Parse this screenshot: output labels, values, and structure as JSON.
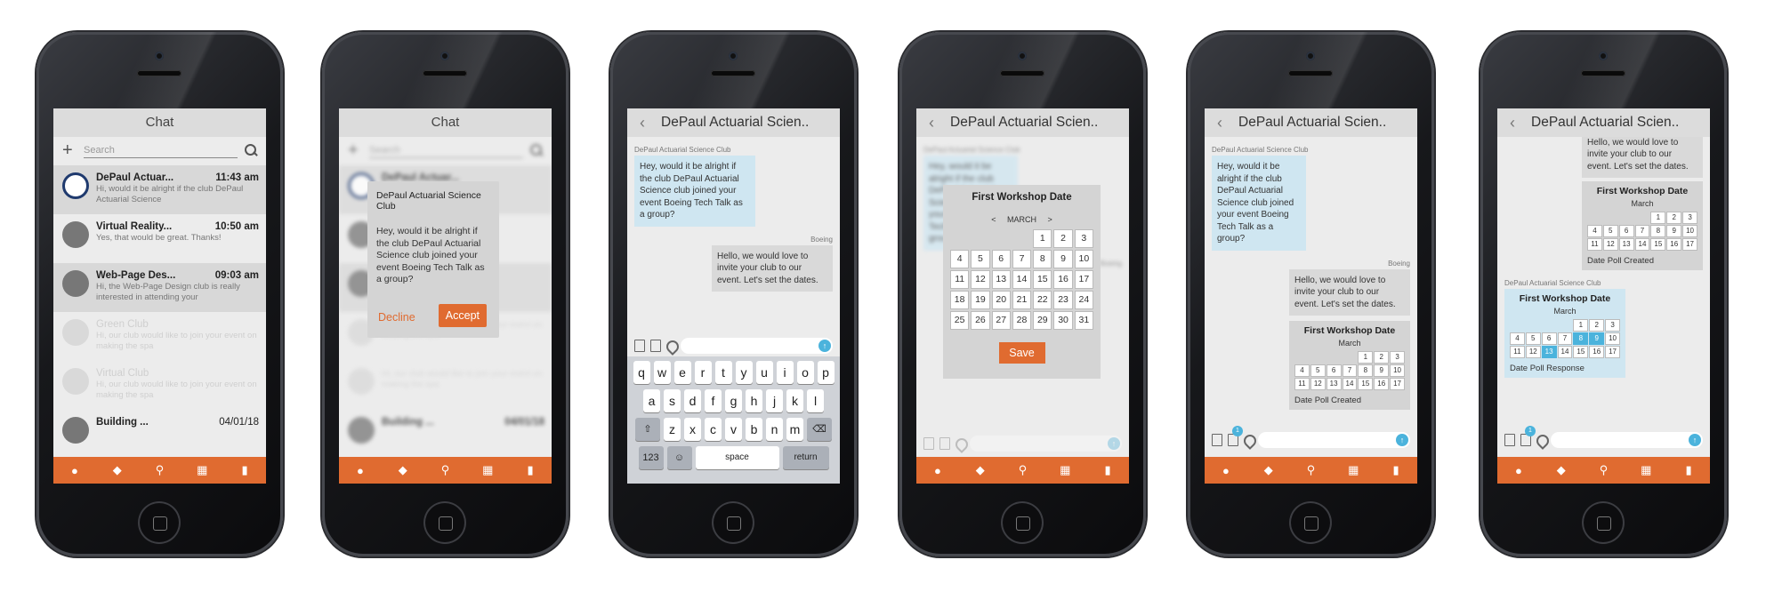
{
  "tabbar_icons": [
    "person-icon",
    "chat-bubble-icon",
    "search-icon",
    "calendar-grid-icon",
    "bookmark-icon"
  ],
  "colors": {
    "accent": "#e06b30",
    "bubble_in": "#cfe6f1",
    "selected": "#4bb3dc"
  },
  "chat_list": {
    "title": "Chat",
    "search_placeholder": "Search",
    "items": [
      {
        "name": "DePaul Actuar...",
        "time": "11:43 am",
        "preview": "Hi, would it be alright if the club DePaul Actuarial Science"
      },
      {
        "name": "Virtual Reality...",
        "time": "10:50 am",
        "preview": "Yes, that would be great. Thanks!"
      },
      {
        "name": "Web-Page Des...",
        "time": "09:03 am",
        "preview": "Hi, the Web-Page Design club is really interested in attending your"
      },
      {
        "name": "Green Club",
        "time": "",
        "preview": "Hi, our club would like to join your event on making the spa"
      },
      {
        "name": "Virtual Club",
        "time": "",
        "preview": "Hi, our club would like to join your event on making the spa"
      },
      {
        "name": "Building ...",
        "time": "04/01/18",
        "preview": ""
      }
    ]
  },
  "request_dialog": {
    "title": "DePaul Actuarial Science Club",
    "body": "Hey, would it be alright if the club DePaul Actuarial Science club joined your event Boeing Tech Talk as a group?",
    "decline": "Decline",
    "accept": "Accept"
  },
  "conversation": {
    "title": "DePaul Actuarial Scien..",
    "club_sender": "DePaul Actuarial Science Club",
    "incoming": "Hey, would it be alright if the club DePaul Actuarial Science club joined your event Boeing Tech Talk as a group?",
    "org_sender": "Boeing",
    "outgoing": "Hello, we would love to invite your club to our event. Let's set the dates."
  },
  "keyboard": {
    "row1": [
      "q",
      "w",
      "e",
      "r",
      "t",
      "y",
      "u",
      "i",
      "o",
      "p"
    ],
    "row2": [
      "a",
      "s",
      "d",
      "f",
      "g",
      "h",
      "j",
      "k",
      "l"
    ],
    "row3": [
      "z",
      "x",
      "c",
      "v",
      "b",
      "n",
      "m"
    ],
    "shift": "⇧",
    "backspace": "⌫",
    "numbers": "123",
    "emoji": "☺",
    "space": "space",
    "return": "return"
  },
  "date_picker": {
    "title": "First Workshop Date",
    "month": "MARCH",
    "prev": "<",
    "next": ">",
    "save": "Save",
    "days": [
      "",
      "",
      "",
      "",
      "1",
      "2",
      "3",
      "4",
      "5",
      "6",
      "7",
      "8",
      "9",
      "10",
      "11",
      "12",
      "13",
      "14",
      "15",
      "16",
      "17",
      "18",
      "19",
      "20",
      "21",
      "22",
      "23",
      "24",
      "25",
      "26",
      "27",
      "28",
      "29",
      "30",
      "31"
    ]
  },
  "poll": {
    "title": "First Workshop Date",
    "month": "March",
    "created": "Date Poll Created",
    "response": "Date Poll Response",
    "days": [
      "",
      "",
      "",
      "",
      "1",
      "2",
      "3",
      "4",
      "5",
      "6",
      "7",
      "8",
      "9",
      "10",
      "11",
      "12",
      "13",
      "14",
      "15",
      "16",
      "17"
    ],
    "selected": [
      "8",
      "9",
      "13"
    ],
    "badge_count": "1"
  }
}
